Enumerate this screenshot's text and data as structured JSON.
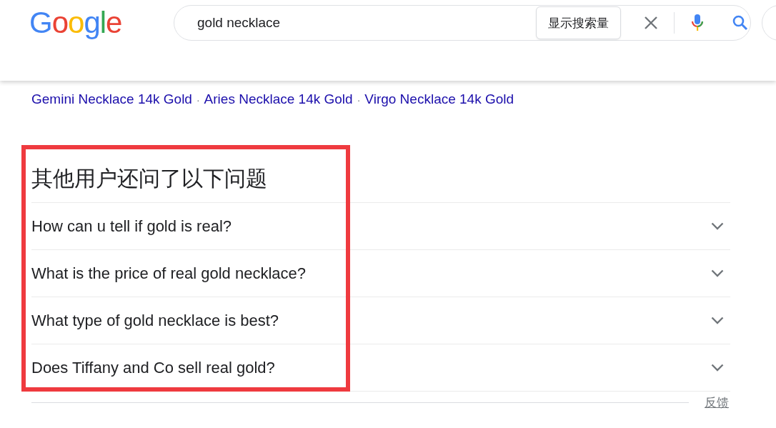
{
  "header": {
    "logo": "Google",
    "search": {
      "value": "gold necklace",
      "volume_button": "显示搜索量"
    }
  },
  "snippet": {
    "links": [
      "Gemini Necklace 14k Gold",
      "Aries Necklace 14k Gold",
      "Virgo Necklace 14k Gold"
    ],
    "separator": "·"
  },
  "people_also_ask": {
    "title": "其他用户还问了以下问题",
    "highlight_box": true,
    "questions": [
      {
        "text": "How can u tell if gold is real?",
        "expanded": false
      },
      {
        "text": "What is the price of real gold necklace?",
        "expanded": false
      },
      {
        "text": "What type of gold necklace is best?",
        "expanded": false
      },
      {
        "text": "Does Tiffany and Co sell real gold?",
        "expanded": false
      }
    ],
    "feedback": "反馈"
  }
}
